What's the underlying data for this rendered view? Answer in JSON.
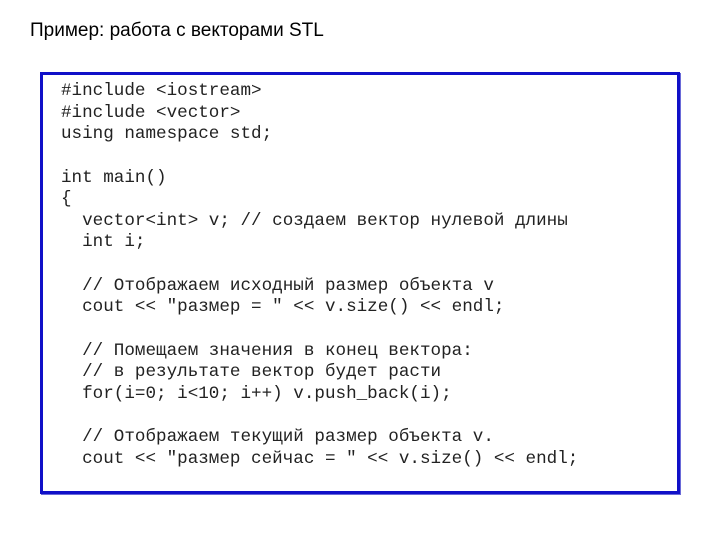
{
  "title": "Пример: работа с векторами STL",
  "code_lines": [
    "#include <iostream>",
    "#include <vector>",
    "using namespace std;",
    "",
    "int main()",
    "{",
    "  vector<int> v; // создаем вектор нулевой длины",
    "  int i;",
    "",
    "  // Отображаем исходный размер объекта v",
    "  cout << \"размер = \" << v.size() << endl;",
    "",
    "  // Помещаем значения в конец вектора:",
    "  // в результате вектор будет расти",
    "  for(i=0; i<10; i++) v.push_back(i);",
    "",
    "  // Отображаем текущий размер объекта v.",
    "  cout << \"размер сейчас = \" << v.size() << endl;"
  ],
  "colors": {
    "box_border": "#1010c8",
    "code_text": "#222222"
  }
}
